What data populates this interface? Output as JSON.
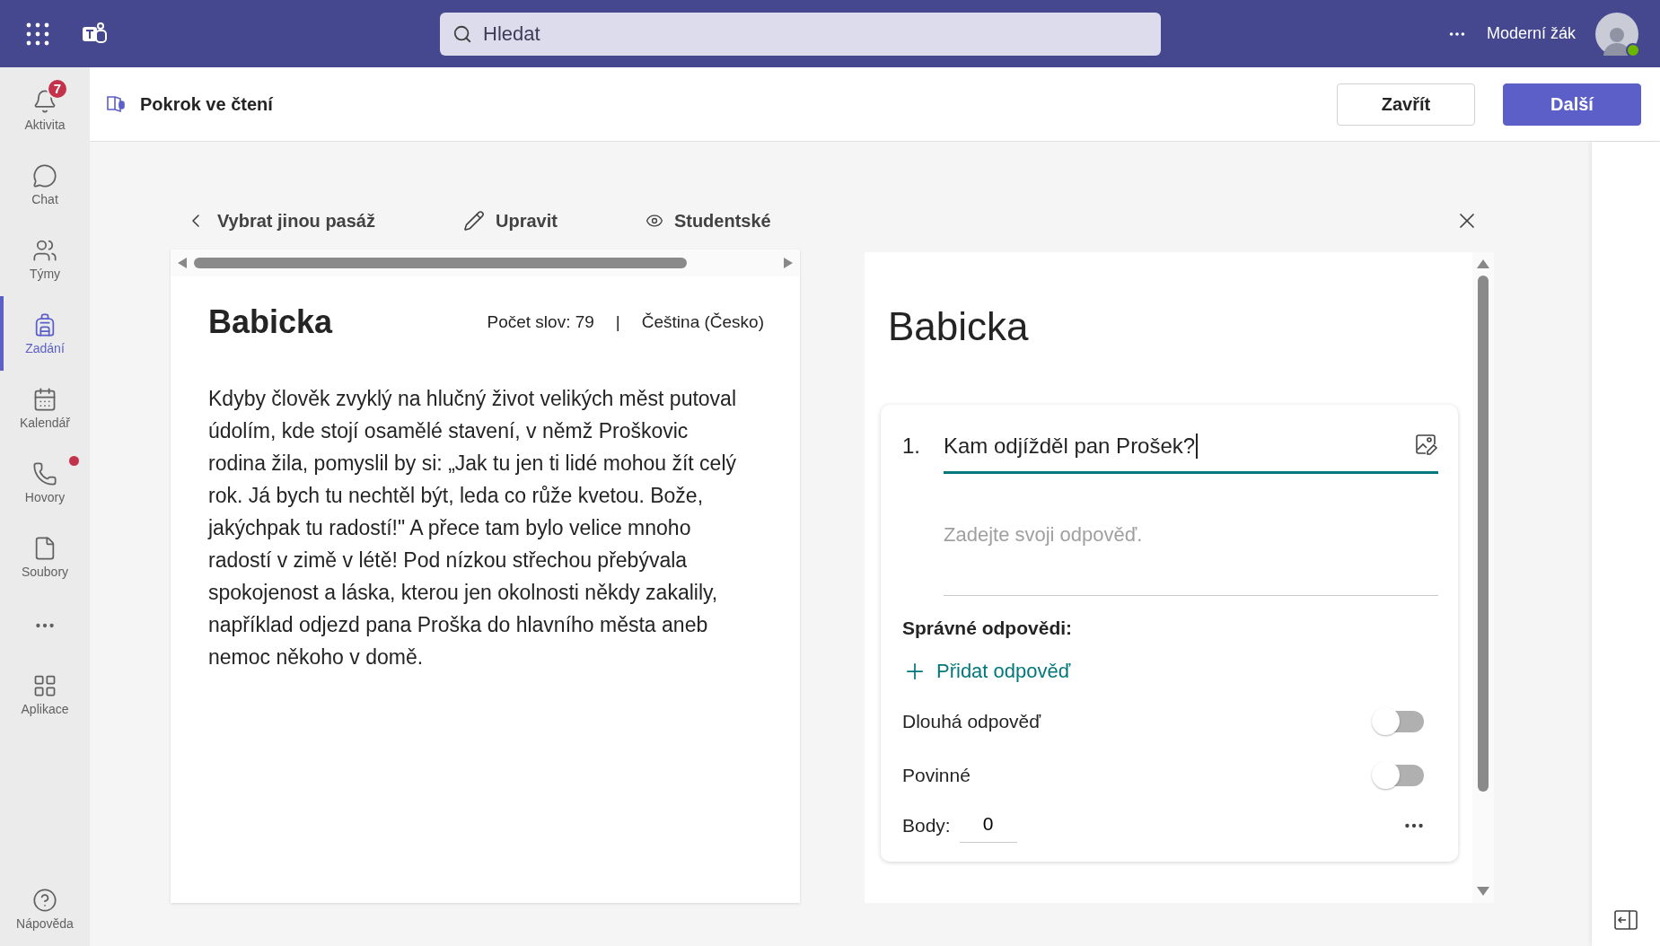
{
  "top_bar": {
    "search": {
      "placeholder": "Hledat"
    },
    "user_name": "Moderní žák"
  },
  "sidebar": {
    "items": [
      {
        "label": "Aktivita",
        "selected": false,
        "badge": "7",
        "notification_dot": false
      },
      {
        "label": "Chat",
        "selected": false,
        "notification_dot": false
      },
      {
        "label": "Týmy",
        "selected": false,
        "notification_dot": false
      },
      {
        "label": "Zadání",
        "selected": true,
        "notification_dot": false
      },
      {
        "label": "Kalendář",
        "selected": false,
        "notification_dot": false
      },
      {
        "label": "Hovory",
        "selected": false,
        "notification_dot": true
      },
      {
        "label": "Soubory",
        "selected": false,
        "notification_dot": false
      }
    ],
    "apps": {
      "label": "Aplikace"
    },
    "help": {
      "label": "Nápověda"
    }
  },
  "header": {
    "title": "Pokrok ve čtení",
    "buttons": [
      {
        "label": "Zavřít",
        "kind": "secondary"
      },
      {
        "label": "Další",
        "kind": "primary"
      }
    ]
  },
  "passage_toolbar": {
    "items": [
      {
        "label": "Vybrat jinou pasáž"
      },
      {
        "label": "Upravit"
      },
      {
        "label": "Studentské"
      }
    ]
  },
  "passage": {
    "title": "Babicka",
    "word_count": "Počet slov: 79",
    "separator": "|",
    "language": "Čeština (Česko)",
    "text": "Kdyby člověk zvyklý na hlučný život velikých měst putoval údolím, kde stojí osamělé stavení, v němž Proškovic rodina žila, pomyslil by si: „Jak tu jen ti lidé mohou žít celý rok. Já bych tu nechtěl být, leda co růže kvetou. Bože, jakýchpak tu radostí!\" A přece tam bylo velice mnoho radostí v zimě v létě! Pod nízkou střechou přebývala spokojenost a láska, kterou jen okolnosti někdy zakalily, například odjezd pana Proška do hlavního města aneb nemoc někoho v domě."
  },
  "quiz": {
    "title": "Babicka",
    "question": {
      "number": "1.",
      "text": "Kam odjížděl pan Prošek?",
      "answer_placeholder": "Zadejte svoji odpověď.",
      "correct_answers_label": "Správné odpovědi:",
      "add_answer": "Přidat odpověď",
      "toggles": [
        {
          "label": "Dlouhá odpověď",
          "on": false
        },
        {
          "label": "Povinné",
          "on": false
        }
      ],
      "points_label": "Body:",
      "points_value": "0"
    }
  }
}
